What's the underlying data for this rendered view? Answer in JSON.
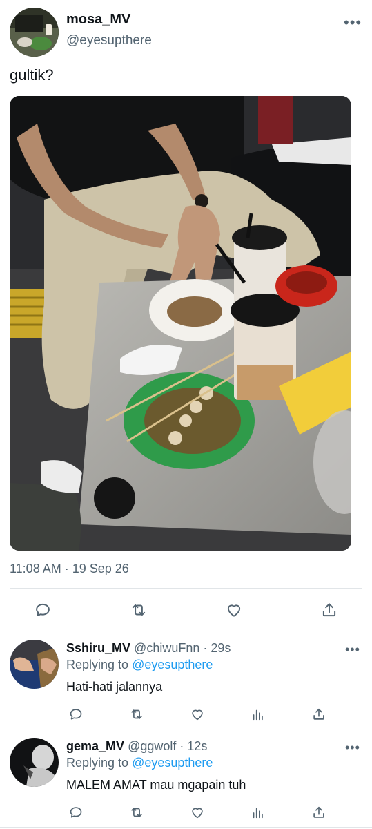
{
  "tweet": {
    "display_name": "mosa_MV",
    "handle": "@eyesupthere",
    "text": "gultik?",
    "timestamp": "11:08 AM · 19 Sep 26",
    "more_icon": "more-horizontal-icon",
    "actions": [
      "reply-icon",
      "retweet-icon",
      "like-icon",
      "share-icon"
    ]
  },
  "replies": [
    {
      "display_name": "Sshiru_MV",
      "meta": "@chiwuFnn · 29s",
      "replying_prefix": "Replying to",
      "replying_to": "@eyesupthere",
      "text": "Hati-hati jalannya"
    },
    {
      "display_name": "gema_MV",
      "meta": "@ggwolf · 12s",
      "replying_prefix": "Replying to",
      "replying_to": "@eyesupthere",
      "text": "MALEM AMAT mau mgapain tuh"
    }
  ],
  "colors": {
    "text": "#0f1419",
    "secondary": "#536471",
    "accent": "#1d9bf0",
    "divider": "#e1e5e8"
  }
}
